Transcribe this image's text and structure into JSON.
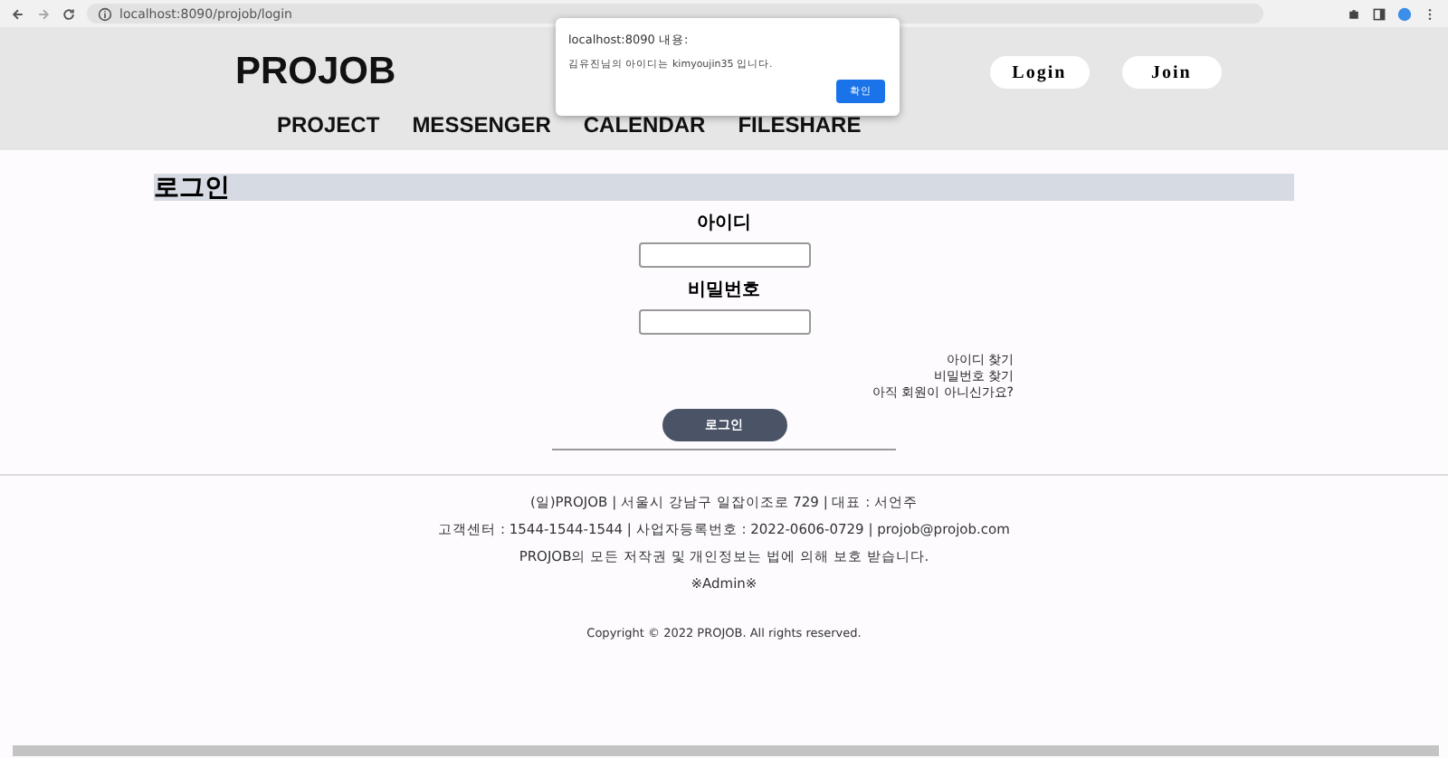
{
  "browser": {
    "url": "localhost:8090/projob/login"
  },
  "header": {
    "logo": "PROJOB",
    "auth_buttons": [
      "Login",
      "Join"
    ],
    "nav": [
      "PROJECT",
      "MESSENGER",
      "CALENDAR",
      "FILESHARE"
    ]
  },
  "page_title": "로그인",
  "form": {
    "id_label": "아이디",
    "password_label": "비밀번호",
    "links": [
      "아이디 찾기",
      "비밀번호 찾기",
      "아직 회원이 아니신가요?"
    ],
    "submit": "로그인"
  },
  "footer": {
    "lines": [
      "(일)PROJOB | 서울시 강남구 일잡이조로 729 | 대표 : 서언주",
      "고객센터 : 1544-1544-1544 | 사업자등록번호 : 2022-0606-0729 | projob@projob.com",
      "PROJOB의 모든 저작권 및 개인정보는 법에 의해 보호 받습니다.",
      "※Admin※"
    ],
    "copyright": "Copyright © 2022 PROJOB. All rights reserved."
  },
  "alert": {
    "title": "localhost:8090 내용:",
    "message": "김유진님의 아이디는 kimyoujin35 입니다.",
    "button": "확인"
  }
}
